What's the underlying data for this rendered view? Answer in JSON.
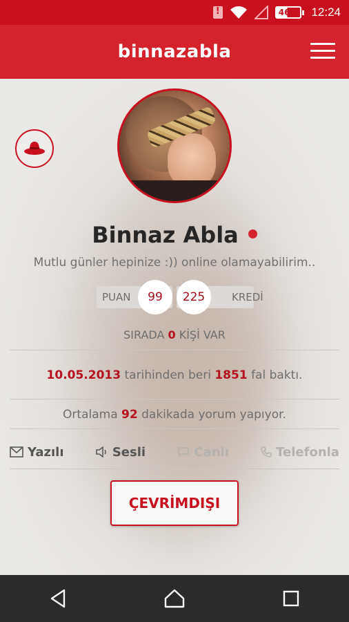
{
  "status_bar": {
    "battery": "46%",
    "time": "12:24",
    "icons": [
      "sim-alert-icon",
      "wifi-icon",
      "signal-icon",
      "battery-icon"
    ]
  },
  "app_bar": {
    "logo": "binnazabla",
    "menu_icon": "hamburger-menu-icon"
  },
  "profile": {
    "name": "Binnaz Abla",
    "status_message": "Mutlu günler hepinize :)) online olamayabilirim..",
    "online_indicator_color": "#d5232d",
    "puan_label": "PUAN",
    "puan_value": "99",
    "kredi_value": "225",
    "kredi_label": "KREDİ"
  },
  "queue": {
    "prefix": "SIRADA ",
    "count": "0",
    "suffix": " KİŞİ VAR"
  },
  "since": {
    "date": "10.05.2013",
    "middle": " tarihinden beri ",
    "count": "1851",
    "suffix": " fal baktı."
  },
  "average": {
    "prefix": "Ortalama ",
    "minutes": "92",
    "suffix": " dakikada yorum yapıyor."
  },
  "channels": [
    {
      "label": "Yazılı",
      "icon": "envelope-icon",
      "enabled": true
    },
    {
      "label": "Sesli",
      "icon": "speaker-icon",
      "enabled": true
    },
    {
      "label": "Canlı",
      "icon": "chat-bubble-icon",
      "enabled": false
    },
    {
      "label": "Telefonla",
      "icon": "phone-icon",
      "enabled": false
    }
  ],
  "offline_button": "ÇEVRİMDIŞI",
  "colors": {
    "brand_red": "#d5232d",
    "status_bar_red": "#c8101e",
    "accent_text_red": "#b5101c",
    "nav_bar": "#2b2b2b"
  }
}
